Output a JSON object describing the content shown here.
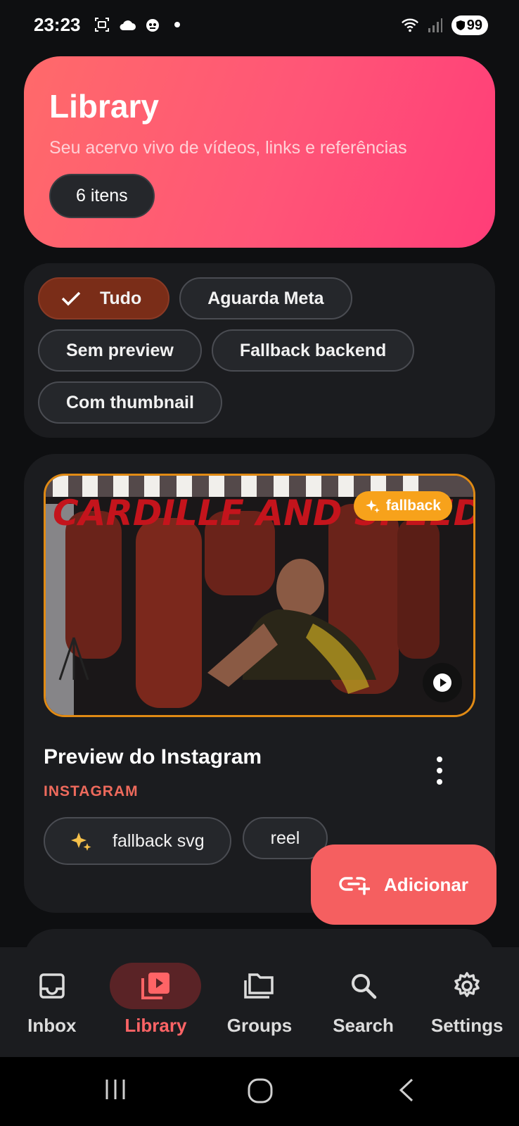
{
  "status_bar": {
    "time": "23:23",
    "battery": "99"
  },
  "header": {
    "title": "Library",
    "subtitle": "Seu acervo vivo de vídeos, links e referências",
    "count_label": "6 itens"
  },
  "filters": [
    {
      "label": "Tudo",
      "active": true
    },
    {
      "label": "Aguarda Meta",
      "active": false
    },
    {
      "label": "Sem preview",
      "active": false
    },
    {
      "label": "Fallback backend",
      "active": false
    },
    {
      "label": "Com thumbnail",
      "active": false
    }
  ],
  "card": {
    "thumbnail_text": "CARDILLE AND SPEED",
    "badge_label": "fallback",
    "title": "Preview do Instagram",
    "source": "INSTAGRAM",
    "tags": [
      "fallback svg",
      "reel"
    ]
  },
  "fab": {
    "label": "Adicionar"
  },
  "bottom_nav": [
    {
      "label": "Inbox",
      "icon": "inbox-icon",
      "active": false
    },
    {
      "label": "Library",
      "icon": "video-library-icon",
      "active": true
    },
    {
      "label": "Groups",
      "icon": "folders-icon",
      "active": false
    },
    {
      "label": "Search",
      "icon": "search-icon",
      "active": false
    },
    {
      "label": "Settings",
      "icon": "gear-icon",
      "active": false
    }
  ],
  "colors": {
    "background": "#0e0f11",
    "hero_start": "#ff6a6a",
    "hero_end": "#ff3d78",
    "active_chip": "#7a2d18",
    "accent": "#f55f60",
    "badge": "#f7a21b"
  }
}
